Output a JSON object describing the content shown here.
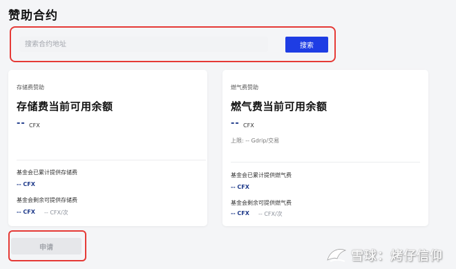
{
  "page": {
    "title": "赞助合约"
  },
  "search": {
    "placeholder": "搜索合约地址",
    "value": "",
    "button_label": "搜索"
  },
  "cards": [
    {
      "kicker": "存储费赞助",
      "title": "存储费当前可用余额",
      "balance_value": "--",
      "balance_unit": "CFX",
      "limit_text": "",
      "provided_label": "基金会已累计提供存储费",
      "provided_value": "-- CFX",
      "remaining_label": "基金会剩余可提供存储费",
      "remaining_value": "-- CFX",
      "remaining_rate": "-- CFX/次"
    },
    {
      "kicker": "燃气费赞助",
      "title": "燃气费当前可用余额",
      "balance_value": "--",
      "balance_unit": "CFX",
      "limit_text": "上限: -- Gdrip/交易",
      "provided_label": "基金会已累计提供燃气费",
      "provided_value": "-- CFX",
      "remaining_label": "基金会剩余可提供燃气费",
      "remaining_value": "-- CFX",
      "remaining_rate": "-- CFX/次"
    }
  ],
  "apply": {
    "button_label": "申请"
  },
  "watermark": {
    "text": "雪球：烤仔信仰"
  },
  "colors": {
    "primary": "#1e3de4",
    "highlight_border": "#e53935",
    "value_text": "#1e3a8a"
  }
}
